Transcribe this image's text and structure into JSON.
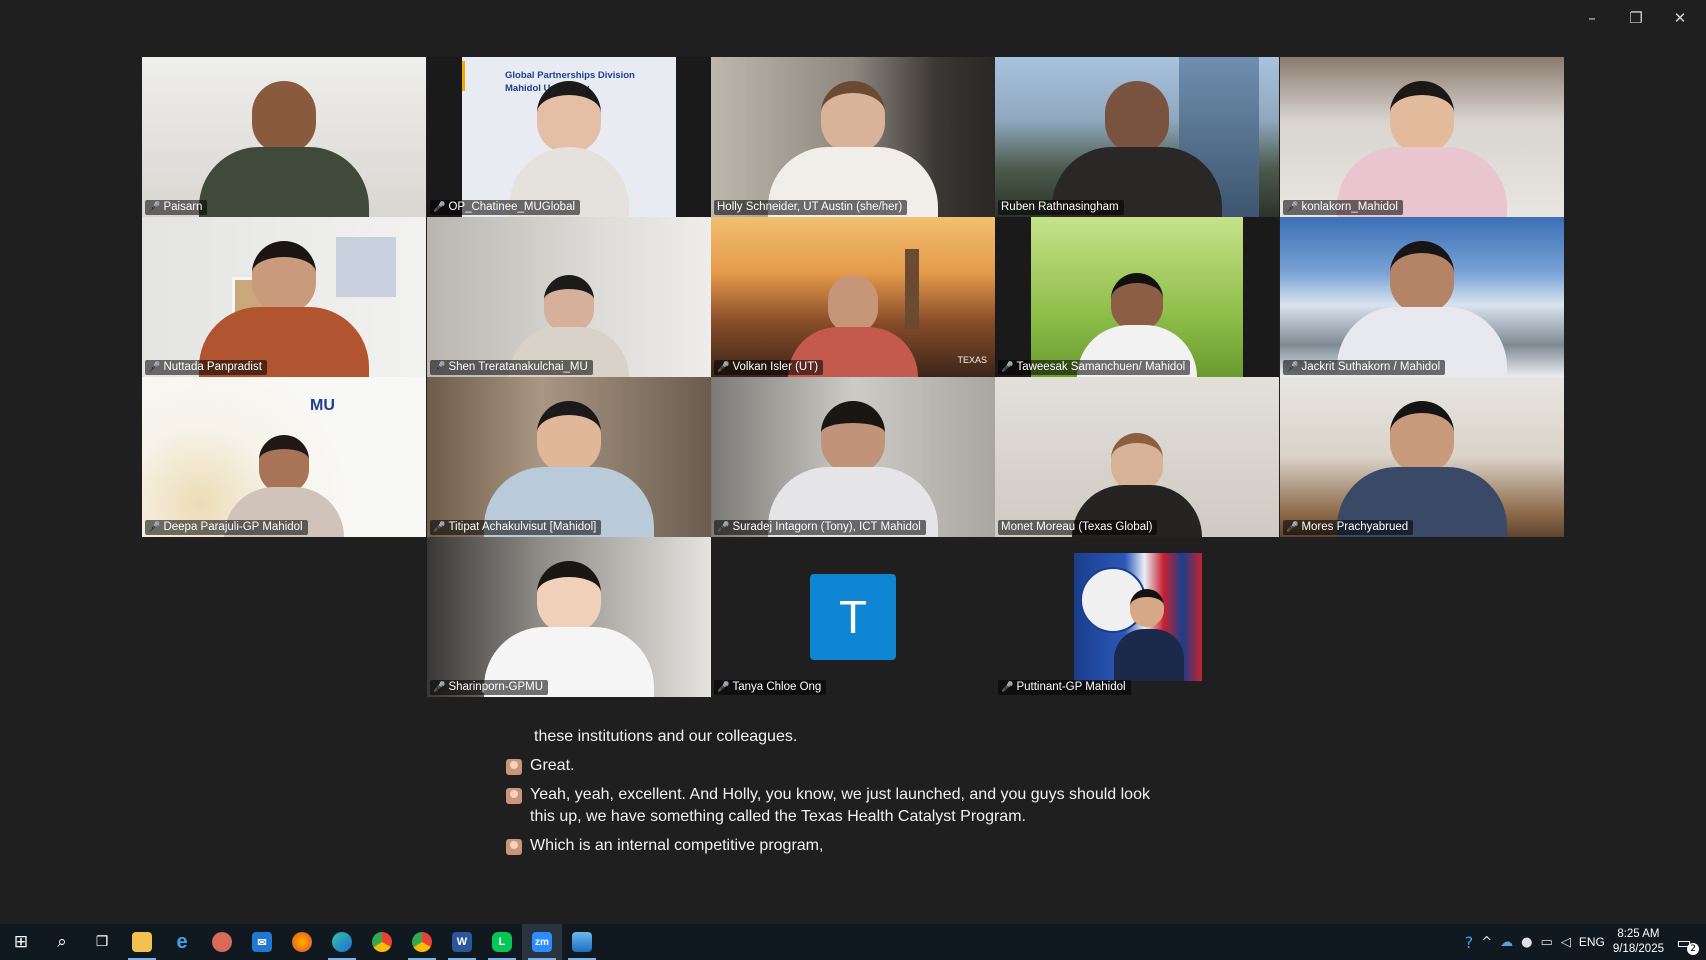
{
  "window": {
    "minimize": "–",
    "restore": "❐",
    "close": "✕"
  },
  "participants": [
    {
      "name": "Paisarn",
      "muted": true
    },
    {
      "name": "OP_Chatinee_MUGlobal",
      "muted": true,
      "banner_line1": "Global Partnerships Division",
      "banner_line2": "Mahidol University"
    },
    {
      "name": "Holly Schneider, UT Austin (she/her)",
      "muted": false
    },
    {
      "name": "Ruben Rathnasingham",
      "muted": false,
      "active_speaker": true
    },
    {
      "name": "konlakorn_Mahidol",
      "muted": true
    },
    {
      "name": "Nuttada Panpradist",
      "muted": true
    },
    {
      "name": "Shen Treratanakulchai_MU",
      "muted": true
    },
    {
      "name": "Volkan Isler (UT)",
      "muted": true,
      "bg_text": "TEXAS"
    },
    {
      "name": "Taweesak Samanchuen/ Mahidol",
      "muted": true
    },
    {
      "name": "Jackrit Suthakorn / Mahidol",
      "muted": true
    },
    {
      "name": "Deepa Parajuli-GP Mahidol",
      "muted": true,
      "logo": "MU"
    },
    {
      "name": "Titipat Achakulvisut [Mahidol]",
      "muted": true
    },
    {
      "name": "Suradej Intagorn (Tony), ICT Mahidol",
      "muted": true
    },
    {
      "name": "Monet Moreau (Texas Global)",
      "muted": false
    },
    {
      "name": "Mores Prachyabrued",
      "muted": true
    },
    {
      "name": "Sharinporn-GPMU",
      "muted": true
    },
    {
      "name": "Tanya Chloe Ong",
      "muted": true,
      "avatar_letter": "T"
    },
    {
      "name": "Puttinant-GP Mahidol",
      "muted": true
    }
  ],
  "mic_off_icon": "🎤",
  "captions": [
    {
      "text": "these institutions and our colleagues.",
      "icon": false
    },
    {
      "text": "Great.",
      "icon": true
    },
    {
      "text": "Yeah, yeah, excellent. And Holly, you know, we just launched, and you guys should look this up, we have something called the Texas Health Catalyst Program.",
      "icon": true
    },
    {
      "text": "Which is an internal competitive program,",
      "icon": true
    }
  ],
  "taskbar": {
    "icons": [
      {
        "name": "start",
        "glyph": "⊞"
      },
      {
        "name": "search",
        "glyph": "⌕"
      },
      {
        "name": "task-view",
        "glyph": "❐"
      },
      {
        "name": "file-explorer",
        "glyph": ""
      },
      {
        "name": "internet-explorer",
        "glyph": "e"
      },
      {
        "name": "app-generic",
        "glyph": ""
      },
      {
        "name": "mail",
        "glyph": "✉"
      },
      {
        "name": "firefox",
        "glyph": ""
      },
      {
        "name": "edge",
        "glyph": ""
      },
      {
        "name": "chrome",
        "glyph": ""
      },
      {
        "name": "chrome-2",
        "glyph": ""
      },
      {
        "name": "word",
        "glyph": "W"
      },
      {
        "name": "line",
        "glyph": "L"
      },
      {
        "name": "zoom",
        "glyph": "zm"
      },
      {
        "name": "photos",
        "glyph": ""
      }
    ],
    "tray": {
      "language": "ENG",
      "time": "8:25 AM",
      "date": "9/18/2025",
      "notifications": "2"
    }
  },
  "colors": {
    "accent_active_speaker": "#39d98a",
    "mic_muted": "#ff4d4f",
    "avatar_bg": "#0e86d4",
    "taskbar_bg": "#101820"
  }
}
